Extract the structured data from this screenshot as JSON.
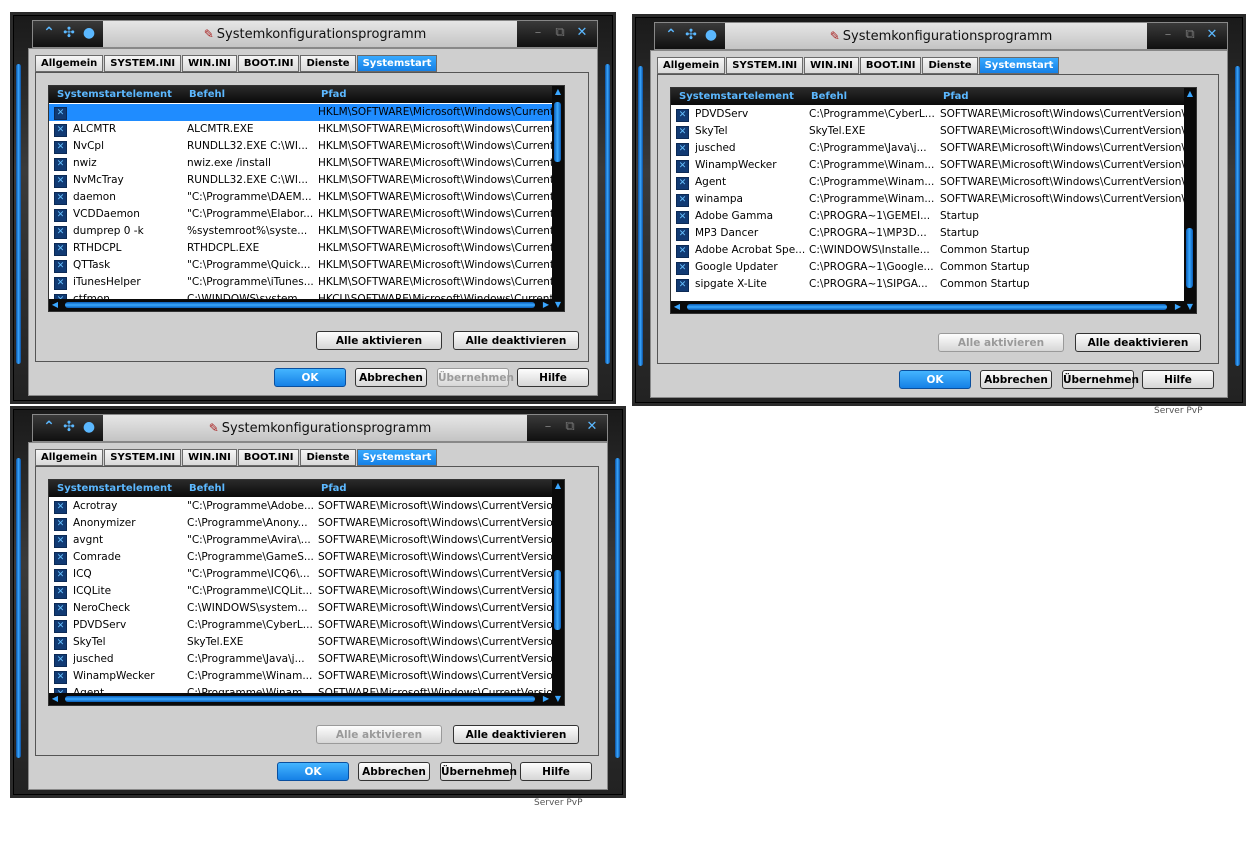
{
  "windows": [
    {
      "title": "Systemkonfigurationsprogramm",
      "tabs": [
        "Allgemein",
        "SYSTEM.INI",
        "WIN.INI",
        "BOOT.INI",
        "Dienste",
        "Systemstart"
      ],
      "active_tab": "Systemstart",
      "columns": [
        "Systemstartelement",
        "Befehl",
        "Pfad"
      ],
      "rows": [
        {
          "name": "",
          "command": "",
          "path": "HKLM\\SOFTWARE\\Microsoft\\Windows\\CurrentVer..."
        },
        {
          "name": "ALCMTR",
          "command": "ALCMTR.EXE",
          "path": "HKLM\\SOFTWARE\\Microsoft\\Windows\\CurrentVer..."
        },
        {
          "name": "NvCpl",
          "command": "RUNDLL32.EXE C:\\WI...",
          "path": "HKLM\\SOFTWARE\\Microsoft\\Windows\\CurrentVer..."
        },
        {
          "name": "nwiz",
          "command": "nwiz.exe /install",
          "path": "HKLM\\SOFTWARE\\Microsoft\\Windows\\CurrentVer..."
        },
        {
          "name": "NvMcTray",
          "command": "RUNDLL32.EXE C:\\WI...",
          "path": "HKLM\\SOFTWARE\\Microsoft\\Windows\\CurrentVer..."
        },
        {
          "name": "daemon",
          "command": "\"C:\\Programme\\DAEM...",
          "path": "HKLM\\SOFTWARE\\Microsoft\\Windows\\CurrentVer..."
        },
        {
          "name": "VCDDaemon",
          "command": "\"C:\\Programme\\Elabor...",
          "path": "HKLM\\SOFTWARE\\Microsoft\\Windows\\CurrentVer..."
        },
        {
          "name": "dumprep 0 -k",
          "command": "%systemroot%\\syste...",
          "path": "HKLM\\SOFTWARE\\Microsoft\\Windows\\CurrentVer..."
        },
        {
          "name": "RTHDCPL",
          "command": "RTHDCPL.EXE",
          "path": "HKLM\\SOFTWARE\\Microsoft\\Windows\\CurrentVer..."
        },
        {
          "name": "QTTask",
          "command": "\"C:\\Programme\\Quick...",
          "path": "HKLM\\SOFTWARE\\Microsoft\\Windows\\CurrentVer..."
        },
        {
          "name": "iTunesHelper",
          "command": "\"C:\\Programme\\iTunes...",
          "path": "HKLM\\SOFTWARE\\Microsoft\\Windows\\CurrentVer..."
        },
        {
          "name": "ctfmon",
          "command": "C:\\WINDOWS\\system...",
          "path": "HKCU\\SOFTWARE\\Microsoft\\Windows\\CurrentVer..."
        }
      ],
      "buttons": {
        "enable_all": "Alle aktivieren",
        "disable_all": "Alle deaktivieren",
        "ok": "OK",
        "cancel": "Abbrechen",
        "apply": "Übernehmen",
        "help": "Hilfe"
      }
    },
    {
      "title": "Systemkonfigurationsprogramm",
      "tabs": [
        "Allgemein",
        "SYSTEM.INI",
        "WIN.INI",
        "BOOT.INI",
        "Dienste",
        "Systemstart"
      ],
      "active_tab": "Systemstart",
      "columns": [
        "Systemstartelement",
        "Befehl",
        "Pfad"
      ],
      "rows": [
        {
          "name": "PDVDServ",
          "command": "C:\\Programme\\CyberL...",
          "path": "SOFTWARE\\Microsoft\\Windows\\CurrentVersion\\Ru"
        },
        {
          "name": "SkyTel",
          "command": "SkyTel.EXE",
          "path": "SOFTWARE\\Microsoft\\Windows\\CurrentVersion\\Ru"
        },
        {
          "name": "jusched",
          "command": "C:\\Programme\\Java\\j...",
          "path": "SOFTWARE\\Microsoft\\Windows\\CurrentVersion\\Ru"
        },
        {
          "name": "WinampWecker",
          "command": "C:\\Programme\\Winam...",
          "path": "SOFTWARE\\Microsoft\\Windows\\CurrentVersion\\Ru"
        },
        {
          "name": "Agent",
          "command": "C:\\Programme\\Winam...",
          "path": "SOFTWARE\\Microsoft\\Windows\\CurrentVersion\\Ru"
        },
        {
          "name": "winampa",
          "command": "C:\\Programme\\Winam...",
          "path": "SOFTWARE\\Microsoft\\Windows\\CurrentVersion\\Ru"
        },
        {
          "name": "Adobe Gamma",
          "command": "C:\\PROGRA~1\\GEMEI...",
          "path": "Startup"
        },
        {
          "name": "MP3 Dancer",
          "command": "C:\\PROGRA~1\\MP3D...",
          "path": "Startup"
        },
        {
          "name": "Adobe Acrobat Spe...",
          "command": "C:\\WINDOWS\\Installe...",
          "path": "Common Startup"
        },
        {
          "name": "Google Updater",
          "command": "C:\\PROGRA~1\\Google...",
          "path": "Common Startup"
        },
        {
          "name": "sipgate X-Lite",
          "command": "C:\\PROGRA~1\\SIPGA...",
          "path": "Common Startup"
        }
      ],
      "buttons": {
        "enable_all": "Alle aktivieren",
        "disable_all": "Alle deaktivieren",
        "ok": "OK",
        "cancel": "Abbrechen",
        "apply": "Übernehmen",
        "help": "Hilfe"
      }
    },
    {
      "title": "Systemkonfigurationsprogramm",
      "tabs": [
        "Allgemein",
        "SYSTEM.INI",
        "WIN.INI",
        "BOOT.INI",
        "Dienste",
        "Systemstart"
      ],
      "active_tab": "Systemstart",
      "columns": [
        "Systemstartelement",
        "Befehl",
        "Pfad"
      ],
      "rows": [
        {
          "name": "Acrotray",
          "command": "\"C:\\Programme\\Adobe...",
          "path": "SOFTWARE\\Microsoft\\Windows\\CurrentVersion\\Ru"
        },
        {
          "name": "Anonymizer",
          "command": "C:\\Programme\\Anony...",
          "path": "SOFTWARE\\Microsoft\\Windows\\CurrentVersion\\Ru"
        },
        {
          "name": "avgnt",
          "command": "\"C:\\Programme\\Avira\\...",
          "path": "SOFTWARE\\Microsoft\\Windows\\CurrentVersion\\Ru"
        },
        {
          "name": "Comrade",
          "command": "C:\\Programme\\GameS...",
          "path": "SOFTWARE\\Microsoft\\Windows\\CurrentVersion\\Ru"
        },
        {
          "name": "ICQ",
          "command": "\"C:\\Programme\\ICQ6\\...",
          "path": "SOFTWARE\\Microsoft\\Windows\\CurrentVersion\\Ru"
        },
        {
          "name": "ICQLite",
          "command": "\"C:\\Programme\\ICQLit...",
          "path": "SOFTWARE\\Microsoft\\Windows\\CurrentVersion\\Ru"
        },
        {
          "name": "NeroCheck",
          "command": "C:\\WINDOWS\\system...",
          "path": "SOFTWARE\\Microsoft\\Windows\\CurrentVersion\\Ru"
        },
        {
          "name": "PDVDServ",
          "command": "C:\\Programme\\CyberL...",
          "path": "SOFTWARE\\Microsoft\\Windows\\CurrentVersion\\Ru"
        },
        {
          "name": "SkyTel",
          "command": "SkyTel.EXE",
          "path": "SOFTWARE\\Microsoft\\Windows\\CurrentVersion\\Ru"
        },
        {
          "name": "jusched",
          "command": "C:\\Programme\\Java\\j...",
          "path": "SOFTWARE\\Microsoft\\Windows\\CurrentVersion\\Ru"
        },
        {
          "name": "WinampWecker",
          "command": "C:\\Programme\\Winam...",
          "path": "SOFTWARE\\Microsoft\\Windows\\CurrentVersion\\Ru"
        },
        {
          "name": "Agent",
          "command": "C:\\Programme\\Winam...",
          "path": "SOFTWARE\\Microsoft\\Windows\\CurrentVersion\\Ru"
        }
      ],
      "buttons": {
        "enable_all": "Alle aktivieren",
        "disable_all": "Alle deaktivieren",
        "ok": "OK",
        "cancel": "Abbrechen",
        "apply": "Übernehmen",
        "help": "Hilfe"
      }
    }
  ],
  "background_fragments": [
    "Server PvP",
    "Server PvP"
  ],
  "colors": {
    "accent": "#1f8cff",
    "header_text": "#5cb8ff",
    "dark_chrome": "#1a1a1a",
    "body": "#cfcfcf"
  },
  "icons": {
    "title_left": [
      "chevron-up-icon",
      "settings-icon",
      "alien-head-icon"
    ],
    "title_right": [
      "minimize-icon",
      "restore-icon",
      "close-icon"
    ],
    "check": "checkbox-checked-icon"
  }
}
